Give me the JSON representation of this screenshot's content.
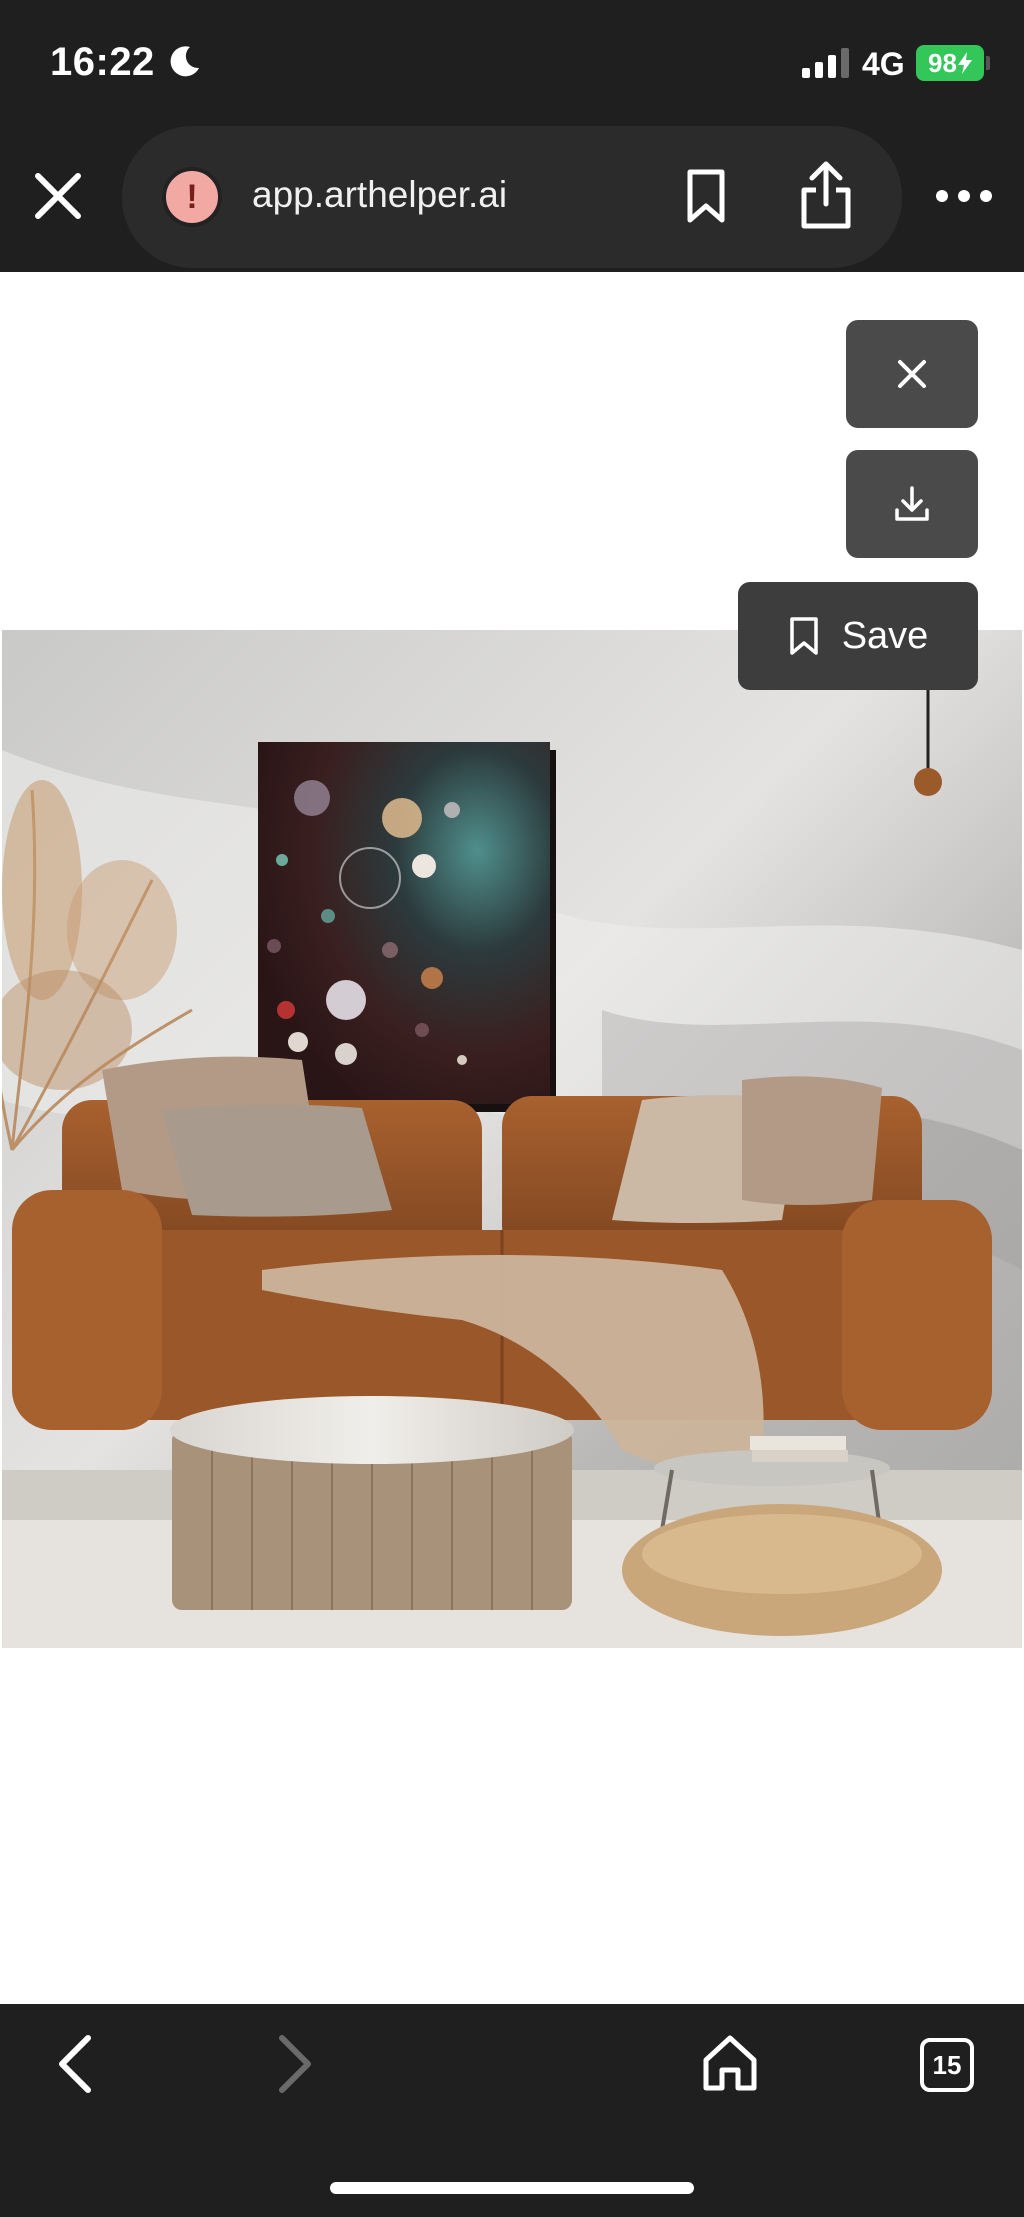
{
  "status_bar": {
    "time": "16:22",
    "network": "4G",
    "battery": "98",
    "icons": [
      "moon-icon",
      "signal-icon",
      "battery-charging-icon"
    ]
  },
  "browser": {
    "url": "app.arthelper.ai",
    "icons": [
      "close-icon",
      "warning-icon",
      "bookmark-icon",
      "share-icon",
      "more-icon"
    ]
  },
  "viewer": {
    "save_label": "Save",
    "icons": [
      "close-icon",
      "download-icon",
      "bookmark-icon"
    ],
    "image_subject": "room-mockup"
  },
  "toolbar": {
    "tab_count": "15",
    "icons": [
      "back-icon",
      "forward-icon",
      "home-icon",
      "tabs-icon"
    ]
  },
  "colors": {
    "chrome": "#1f1f1f",
    "pill": "#2b2b2b",
    "overlay_button": "#4a4a4a",
    "battery": "#33c759",
    "warning_badge": "#f2a9a3"
  }
}
